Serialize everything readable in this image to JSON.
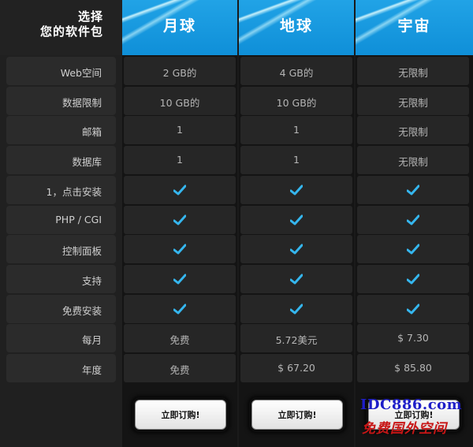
{
  "corner": {
    "line1": "选择",
    "line2": "您的软件包"
  },
  "plans": [
    {
      "name": "月球",
      "button": "立即订购!"
    },
    {
      "name": "地球",
      "button": "立即订购!"
    },
    {
      "name": "宇宙",
      "button": "立即订购!"
    }
  ],
  "rows": [
    {
      "label": "Web空间",
      "values": [
        "2 GB的",
        "4 GB的",
        "无限制"
      ]
    },
    {
      "label": "数据限制",
      "values": [
        "10 GB的",
        "10 GB的",
        "无限制"
      ]
    },
    {
      "label": "邮箱",
      "values": [
        "1",
        "1",
        "无限制"
      ]
    },
    {
      "label": "数据库",
      "values": [
        "1",
        "1",
        "无限制"
      ]
    },
    {
      "label": "1，点击安装",
      "values": [
        "check",
        "check",
        "check"
      ]
    },
    {
      "label": "PHP / CGI",
      "values": [
        "check",
        "check",
        "check"
      ]
    },
    {
      "label": "控制面板",
      "values": [
        "check",
        "check",
        "check"
      ]
    },
    {
      "label": "支持",
      "values": [
        "check",
        "check",
        "check"
      ]
    },
    {
      "label": "免费安装",
      "values": [
        "check",
        "check",
        "check"
      ]
    },
    {
      "label": "每月",
      "values": [
        "免费",
        "5.72美元",
        "$ 7.30"
      ]
    },
    {
      "label": "年度",
      "values": [
        "免费",
        "$ 67.20",
        "$ 85.80"
      ]
    }
  ],
  "watermark": {
    "line1": "IDC886.com",
    "line2": "免费国外空间"
  },
  "colors": {
    "accent": "#1fa8ea",
    "check": "#35b6ee"
  },
  "icons": {
    "check": "check-icon"
  }
}
